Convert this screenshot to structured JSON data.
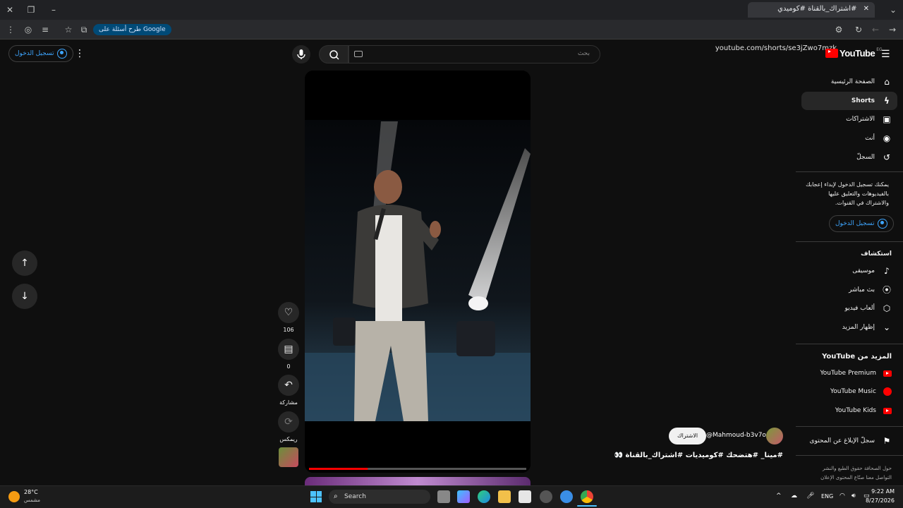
{
  "browser": {
    "tab_title": "‎#اشتراك_بالقناة #كوميدي",
    "google_pill": "طرح أسئلة على Google",
    "url": "youtube.com/shorts/se3jZwo7mzk"
  },
  "masthead": {
    "signin_label": "تسجيل الدخول",
    "search_placeholder": "بحث",
    "logo_text": "YouTube",
    "logo_country": "EG"
  },
  "sidebar": {
    "main_items": [
      {
        "label": "الصفحة الرئيسية",
        "icon": "home-icon"
      },
      {
        "label": "Shorts",
        "icon": "shorts-icon"
      },
      {
        "label": "الاشتراكات",
        "icon": "subscriptions-icon"
      },
      {
        "label": "أنت",
        "icon": "you-icon"
      },
      {
        "label": "السجلّ",
        "icon": "history-icon"
      }
    ],
    "signin_prompt": "يمكنك تسجيل الدخول لإبداء إعجابك بالفيديوهات والتعليق عليها والاشتراك في القنوات.",
    "signin_button": "تسجيل الدخول",
    "explore_heading": "استكشاف",
    "explore_items": [
      {
        "label": "موسيقى",
        "icon": "music-icon"
      },
      {
        "label": "بث مباشر",
        "icon": "live-icon"
      },
      {
        "label": "ألعاب فيديو",
        "icon": "gaming-icon"
      },
      {
        "label": "إظهار المزيد",
        "icon": "chevron-down-icon"
      }
    ],
    "more_heading": "المزيد من YouTube",
    "more_items": [
      {
        "label": "YouTube Premium"
      },
      {
        "label": "YouTube Music"
      },
      {
        "label": "YouTube Kids"
      }
    ],
    "report_label": "سجلّ الإبلاغ عن المحتوى",
    "footer_line1": "حول  الصحافة  حقوق الطبع والنشر",
    "footer_line2": "التواصل معنا  صنّاع المحتوى  الإعلان"
  },
  "short": {
    "likes": "106",
    "comments": "0",
    "share_label": "مشاركة",
    "remix_label": "ريمكس",
    "channel": "@Mahmoud-b3v7o",
    "subscribe": "الاشتراك",
    "title": "#مينا_ #هتضحك #كوميديات #اشتراك_بالقناة 👀",
    "progress_fraction": 0.27
  },
  "taskbar": {
    "weather_temp": "28°C",
    "weather_desc": "مشمس",
    "search_label": "Search",
    "language": "ENG",
    "time": "9:22 AM",
    "date": "8/27/2026"
  },
  "colors": {
    "accent_blue": "#3ea6ff",
    "youtube_red": "#ff0000"
  }
}
